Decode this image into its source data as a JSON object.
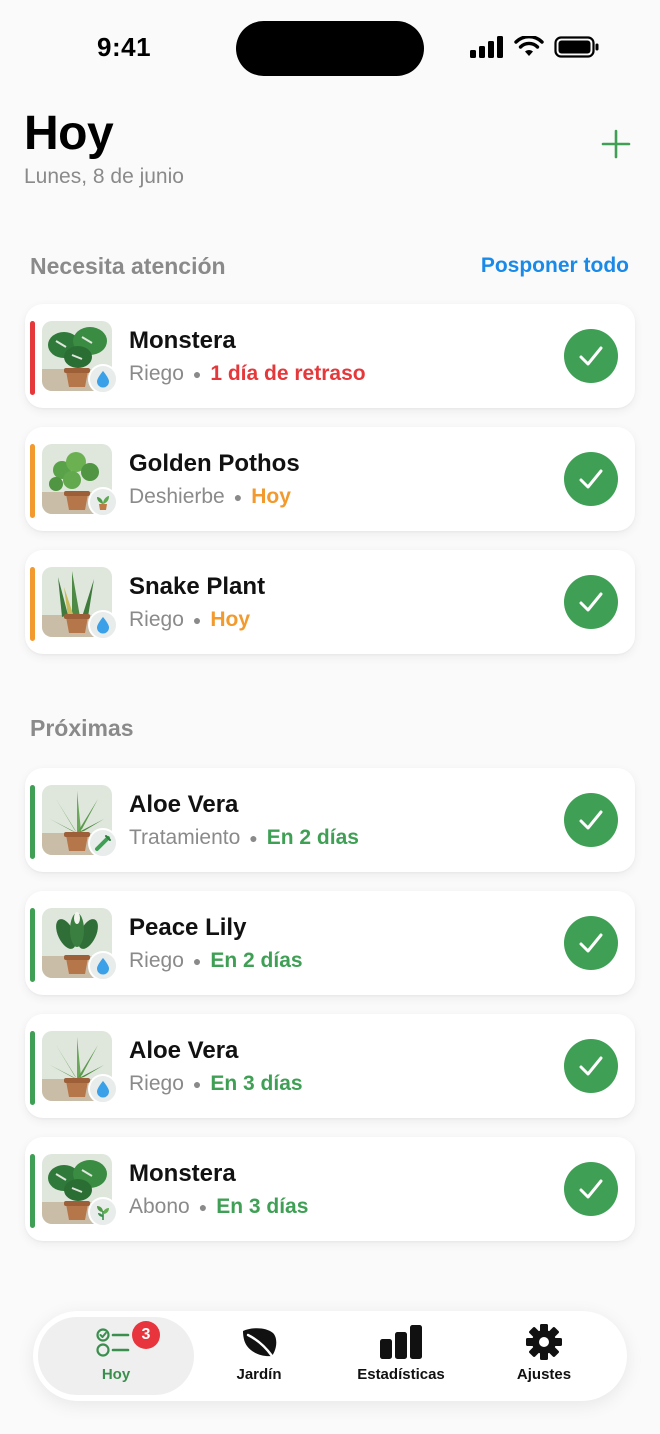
{
  "status_bar": {
    "time": "9:41"
  },
  "header": {
    "title": "Hoy",
    "date": "Lunes, 8 de junio"
  },
  "attention": {
    "title": "Necesita atención",
    "action": "Posponer todo",
    "tasks": [
      {
        "plant": "Monstera",
        "task": "Riego",
        "due": "1 día de retraso",
        "status": "overdue",
        "badge_icon": "water-drop-icon"
      },
      {
        "plant": "Golden Pothos",
        "task": "Deshierbe",
        "due": "Hoy",
        "status": "today",
        "badge_icon": "potted-plant-icon"
      },
      {
        "plant": "Snake Plant",
        "task": "Riego",
        "due": "Hoy",
        "status": "today",
        "badge_icon": "water-drop-icon"
      }
    ]
  },
  "upcoming": {
    "title": "Próximas",
    "tasks": [
      {
        "plant": "Aloe Vera",
        "task": "Tratamiento",
        "due": "En 2 días",
        "status": "upcoming",
        "badge_icon": "treatment-icon"
      },
      {
        "plant": "Peace Lily",
        "task": "Riego",
        "due": "En 2 días",
        "status": "upcoming",
        "badge_icon": "water-drop-icon"
      },
      {
        "plant": "Aloe Vera",
        "task": "Riego",
        "due": "En 3 días",
        "status": "upcoming",
        "badge_icon": "water-drop-icon"
      },
      {
        "plant": "Monstera",
        "task": "Abono",
        "due": "En 3 días",
        "status": "upcoming",
        "badge_icon": "fertilizer-icon"
      }
    ]
  },
  "tab_bar": {
    "tabs": [
      {
        "label": "Hoy",
        "badge": "3",
        "active": true,
        "icon": "checklist-icon"
      },
      {
        "label": "Jardín",
        "active": false,
        "icon": "leaf-icon"
      },
      {
        "label": "Estadísticas",
        "active": false,
        "icon": "bar-chart-icon"
      },
      {
        "label": "Ajustes",
        "active": false,
        "icon": "gear-icon"
      }
    ]
  },
  "colors": {
    "overdue": "#e5383b",
    "today": "#f29a2e",
    "upcoming": "#3fa055",
    "accent_blue": "#1a8ae8",
    "check_green": "#3fa055"
  }
}
